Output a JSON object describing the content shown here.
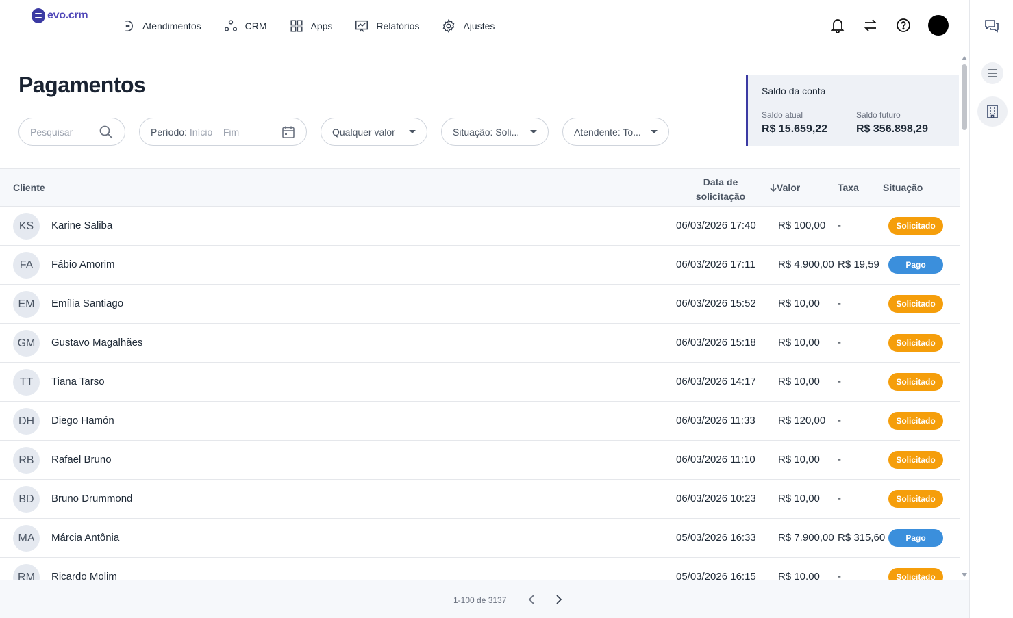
{
  "app": {
    "logo_text": "evo.crm",
    "brand_color": "#3b3aa3"
  },
  "nav": [
    {
      "label": "Atendimentos",
      "icon": "atendimentos-icon"
    },
    {
      "label": "CRM",
      "icon": "crm-icon"
    },
    {
      "label": "Apps",
      "icon": "apps-grid-icon"
    },
    {
      "label": "Relatórios",
      "icon": "reports-chart-icon"
    },
    {
      "label": "Ajustes",
      "icon": "gear-icon"
    }
  ],
  "page": {
    "title": "Pagamentos"
  },
  "filters": {
    "search_placeholder": "Pesquisar",
    "period_label": "Período:",
    "period_start": "Início",
    "period_sep": "–",
    "period_end": "Fim",
    "valor": "Qualquer valor",
    "situacao": "Situação: Soli...",
    "atendente": "Atendente: To..."
  },
  "balance": {
    "title": "Saldo da conta",
    "current_label": "Saldo atual",
    "current_value": "R$ 15.659,22",
    "future_label": "Saldo futuro",
    "future_value": "R$ 356.898,29"
  },
  "table": {
    "headers": {
      "client": "Cliente",
      "date_line1": "Data de",
      "date_line2": "solicitação",
      "valor": "Valor",
      "taxa": "Taxa",
      "situacao": "Situação"
    },
    "rows": [
      {
        "initials": "KS",
        "name": "Karine Saliba",
        "date": "06/03/2026 17:40",
        "valor": "R$ 100,00",
        "taxa": "-",
        "status": "Solicitado",
        "status_color": "orange"
      },
      {
        "initials": "FA",
        "name": "Fábio Amorim",
        "date": "06/03/2026 17:11",
        "valor": "R$ 4.900,00",
        "taxa": "R$ 19,59",
        "status": "Pago",
        "status_color": "blue"
      },
      {
        "initials": "EM",
        "name": "Emília Santiago",
        "date": "06/03/2026 15:52",
        "valor": "R$ 10,00",
        "taxa": "-",
        "status": "Solicitado",
        "status_color": "orange"
      },
      {
        "initials": "GM",
        "name": "Gustavo Magalhães",
        "date": "06/03/2026 15:18",
        "valor": "R$ 10,00",
        "taxa": "-",
        "status": "Solicitado",
        "status_color": "orange"
      },
      {
        "initials": "TT",
        "name": "Tiana Tarso",
        "date": "06/03/2026 14:17",
        "valor": "R$ 10,00",
        "taxa": "-",
        "status": "Solicitado",
        "status_color": "orange"
      },
      {
        "initials": "DH",
        "name": "Diego Hamón",
        "date": "06/03/2026 11:33",
        "valor": "R$ 120,00",
        "taxa": "-",
        "status": "Solicitado",
        "status_color": "orange"
      },
      {
        "initials": "RB",
        "name": "Rafael Bruno",
        "date": "06/03/2026 11:10",
        "valor": "R$ 10,00",
        "taxa": "-",
        "status": "Solicitado",
        "status_color": "orange"
      },
      {
        "initials": "BD",
        "name": "Bruno Drummond",
        "date": "06/03/2026 10:23",
        "valor": "R$ 10,00",
        "taxa": "-",
        "status": "Solicitado",
        "status_color": "orange"
      },
      {
        "initials": "MA",
        "name": "Márcia Antônia",
        "date": "05/03/2026 16:33",
        "valor": "R$ 7.900,00",
        "taxa": "R$ 315,60",
        "status": "Pago",
        "status_color": "blue"
      },
      {
        "initials": "RM",
        "name": "Ricardo Molim",
        "date": "05/03/2026 16:15",
        "valor": "R$ 10,00",
        "taxa": "-",
        "status": "Solicitado",
        "status_color": "orange"
      }
    ]
  },
  "pagination": {
    "text": "1-100 de 3137"
  }
}
